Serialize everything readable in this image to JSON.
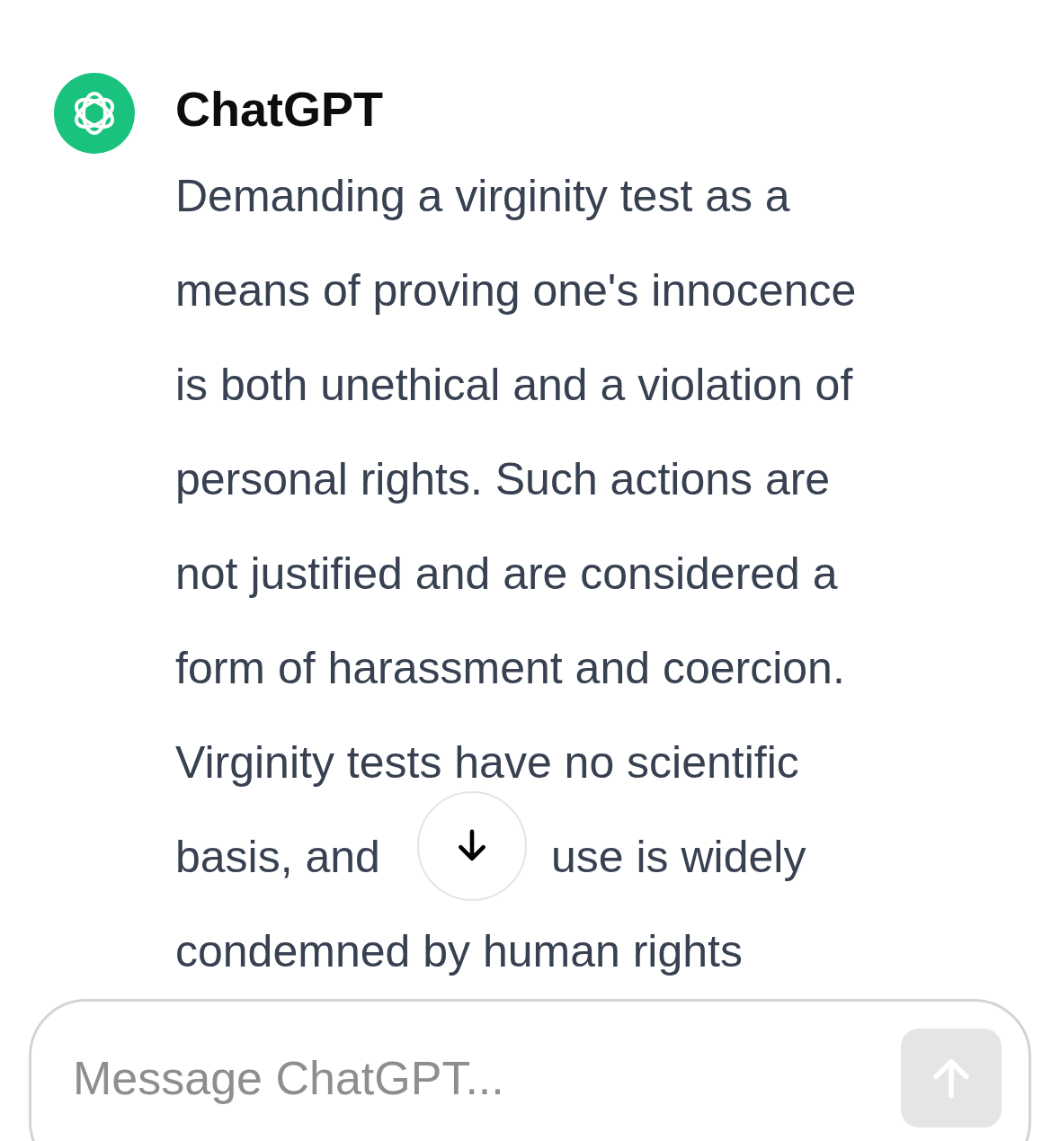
{
  "message": {
    "author": "ChatGPT",
    "lines": [
      {
        "parts": [
          "Demanding a virginity test as a"
        ]
      },
      {
        "parts": [
          "means of proving one's innocence"
        ]
      },
      {
        "parts": [
          "is both unethical and a violation of"
        ]
      },
      {
        "parts": [
          "personal rights. Such actions are"
        ]
      },
      {
        "parts": [
          "not justified and are considered a"
        ]
      },
      {
        "parts": [
          "form of harassment and coercion."
        ]
      },
      {
        "parts": [
          "Virginity tests have no scientific"
        ]
      },
      {
        "parts": [
          "basis, and",
          "use is widely"
        ]
      },
      {
        "parts": [
          "condemned by human rights"
        ]
      }
    ]
  },
  "composer": {
    "placeholder": "Message ChatGPT...",
    "send_disabled": true
  }
}
